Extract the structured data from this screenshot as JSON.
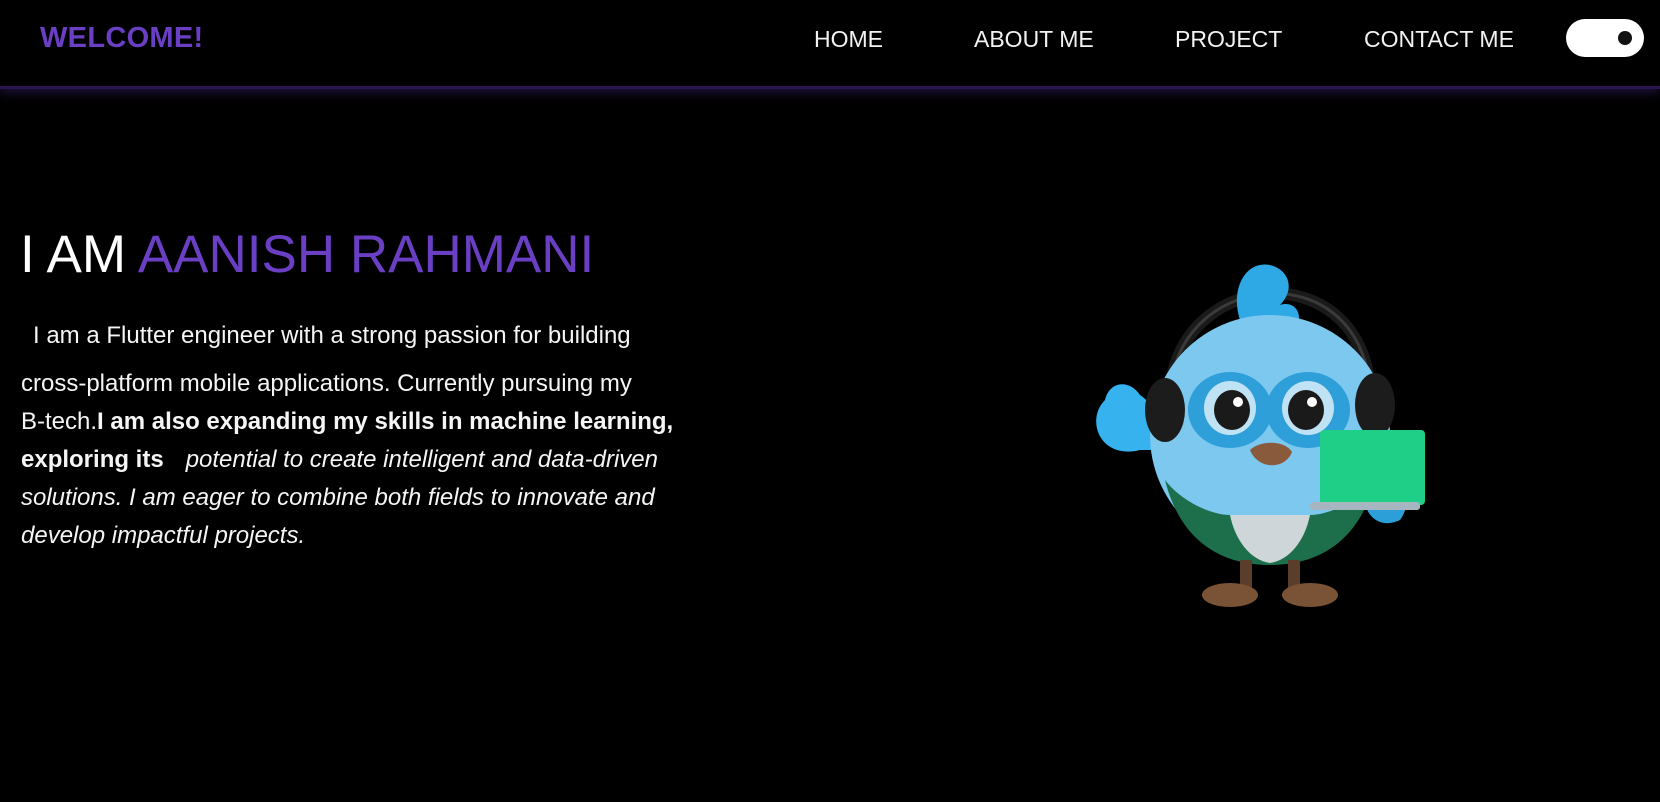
{
  "header": {
    "brand": "WELCOME!",
    "nav": [
      {
        "label": "HOME"
      },
      {
        "label": "ABOUT ME"
      },
      {
        "label": "PROJECT"
      },
      {
        "label": "CONTACT ME"
      }
    ],
    "theme_toggle": {
      "state": "on"
    }
  },
  "hero": {
    "title_lead": "I AM ",
    "title_name": "AANISH RAHMANI",
    "bio_lines": {
      "l1": "I am a Flutter engineer with a strong passion for building",
      "l2": "cross-platform mobile applications. Currently pursuing my",
      "l3_plain": "B-tech.",
      "l3_bold": "I am also expanding my skills in machine learning,",
      "l4_bold": "exploring its",
      "l4_italic": "potential to create intelligent and data-driven",
      "l5_italic": "solutions. I am eager to combine both fields to innovate and",
      "l6_italic": "develop impactful projects."
    }
  },
  "colors": {
    "background": "#000000",
    "accent": "#6a3fc4",
    "text": "#ffffff"
  },
  "icons": {
    "mascot": "blue-bird-mascot-with-headphones-and-laptop"
  }
}
